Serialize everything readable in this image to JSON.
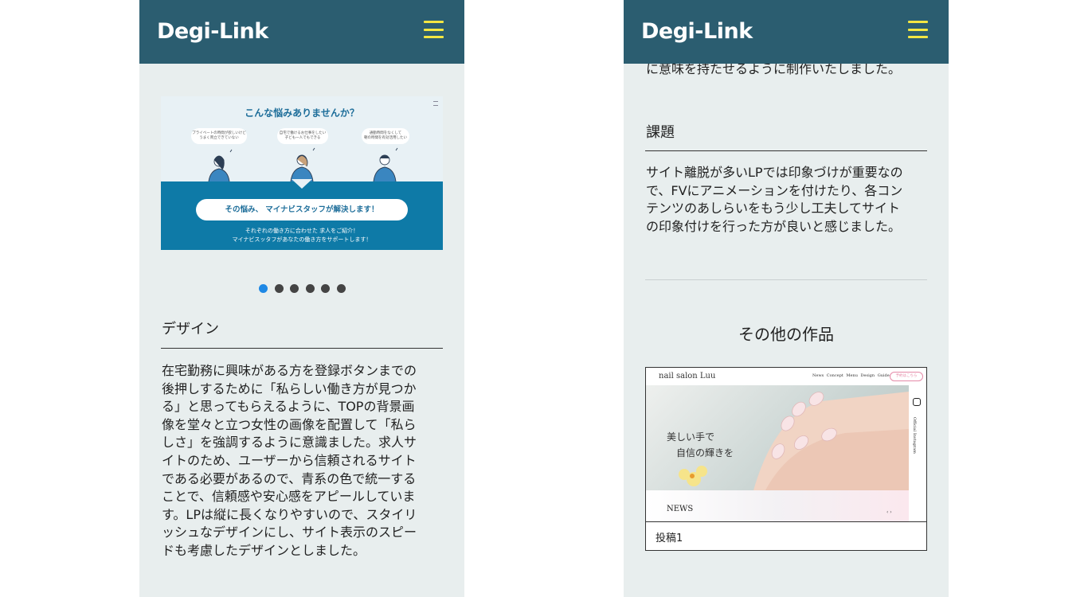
{
  "left": {
    "header": {
      "logo": "Degi-Link"
    },
    "slide": {
      "title": "こんな悩みありませんか？",
      "bubbles": [
        "プライベートの時間が欲しいけど\nうまく両立できていない",
        "自宅で働けるお仕事をしたい\n子ども一人でもできる",
        "通勤時間をなくして\n朝の時間を有効活用したい"
      ],
      "cta": "その悩み、 マイナビスタッフが解決します！",
      "subtext_line1": "それぞれの働き方に合わせた 求人をご紹介！",
      "subtext_line2": "マイナビスッタフがあなたの働き方をサポートします！"
    },
    "carousel": {
      "count": 6,
      "active_index": 0
    },
    "design_section": {
      "title": "デザイン",
      "lines": [
        "在宅勤務に興味がある方を登録ボタンまでの",
        "後押しするために「私らしい働き方が見つか",
        "る」と思ってもらえるように、TOPの背景画",
        "像を堂々と立つ女性の画像を配置して「私ら",
        "しさ」を強調するように意識ました。求人サ",
        "イトのため、ユーザーから信頼されるサイト",
        "である必要があるので、青系の色で統一する",
        "ことで、信頼感や安心感をアピールしていま",
        "す。LPは縦に長くなりやすいので、スタイリ",
        "ッシュなデザインにし、サイト表示のスピー",
        "ドも考慮したデザインとしました。"
      ]
    }
  },
  "right": {
    "header": {
      "logo": "Degi-Link"
    },
    "scrolled_line": "に意味を持たせるように制作いたしました。",
    "issue_section": {
      "title": "課題",
      "lines": [
        "サイト離脱が多いLPでは印象づけが重要なの",
        "で、FVにアニメーションを付けたり、各コン",
        "テンツのあしらいをもう少し工夫してサイト",
        "の印象付けを行った方が良いと感じました。"
      ]
    },
    "other_works": {
      "heading": "その他の作品",
      "card": {
        "site_logo": "nail salon Luu",
        "nav": [
          "News",
          "Concept",
          "Menu",
          "Design",
          "Guide"
        ],
        "nav_button": "予約はこちら",
        "headline_line1": "美しい手で",
        "headline_line2": "自信の輝きを",
        "side_label": "Official Instagram",
        "news_label": "NEWS",
        "caption": "投稿1"
      }
    }
  },
  "colors": {
    "header_bg": "#2b5d70",
    "burger": "#f3e642",
    "page_bg": "#e8eeee",
    "accent_blue": "#0e7aa7",
    "dot_active": "#1e88e5"
  }
}
